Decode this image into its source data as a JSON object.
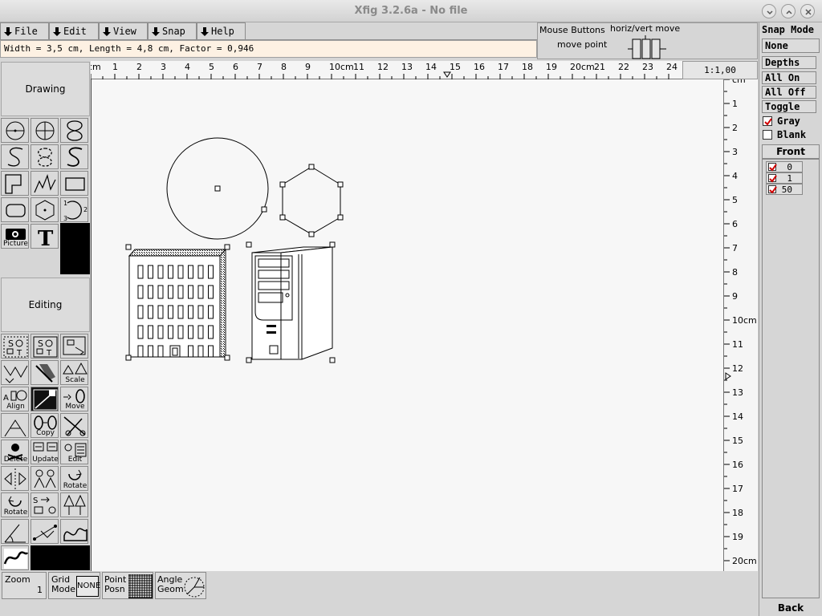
{
  "window": {
    "title": "Xfig 3.2.6a - No file",
    "controls": [
      "minimize-icon",
      "maximize-icon",
      "close-icon"
    ]
  },
  "menubar": {
    "items": [
      {
        "label": "File"
      },
      {
        "label": "Edit"
      },
      {
        "label": "View"
      },
      {
        "label": "Snap"
      },
      {
        "label": "Help"
      }
    ]
  },
  "message": {
    "text": "Width = 3,5 cm, Length = 4,8 cm, Factor = 0,946"
  },
  "mouse_panel": {
    "title": "Mouse Buttons",
    "left_action": "move point",
    "right_action": "horiz/vert move"
  },
  "zoom_display": "1:1,00",
  "modes": {
    "drawing_label": "Drawing",
    "editing_label": "Editing"
  },
  "drawing_tools": [
    {
      "icon": "circle-by-radius-icon"
    },
    {
      "icon": "circle-by-diameter-icon"
    },
    {
      "icon": "closed-spline-icon"
    },
    {
      "icon": "open-approx-spline-icon"
    },
    {
      "icon": "closed-approx-spline-icon"
    },
    {
      "icon": "open-interp-spline-icon"
    },
    {
      "icon": "polygon-icon"
    },
    {
      "icon": "polyline-icon"
    },
    {
      "icon": "box-icon"
    },
    {
      "icon": "rounded-box-icon"
    },
    {
      "icon": "regular-polygon-icon"
    },
    {
      "icon": "arc-icon"
    },
    {
      "icon": "picture-icon",
      "label": "Picture"
    },
    {
      "icon": "text-icon",
      "glyph": "T"
    },
    {
      "icon": "library-icon"
    }
  ],
  "editing_tools": [
    {
      "icon": "glue-compound-icon"
    },
    {
      "icon": "break-compound-icon"
    },
    {
      "icon": "open-compound-icon"
    },
    {
      "icon": "add-delete-point-icon"
    },
    {
      "icon": "add-arrow-icon"
    },
    {
      "icon": "scale-icon",
      "label": "Scale"
    },
    {
      "icon": "align-icon",
      "label": "Align"
    },
    {
      "icon": "move-point-icon",
      "selected": true
    },
    {
      "icon": "move-icon",
      "label": "Move"
    },
    {
      "icon": "add-point-icon"
    },
    {
      "icon": "copy-icon",
      "label": "Copy"
    },
    {
      "icon": "cut-icon"
    },
    {
      "icon": "delete-icon",
      "label": "Delete"
    },
    {
      "icon": "update-icon",
      "label": "Update"
    },
    {
      "icon": "edit-icon",
      "label": "Edit"
    },
    {
      "icon": "flip-icon"
    },
    {
      "icon": "flip-people-icon"
    },
    {
      "icon": "rotate-icon",
      "label": "Rotate"
    },
    {
      "icon": "rotate-ccw-icon",
      "label": "Rotate"
    },
    {
      "icon": "convert-icon"
    },
    {
      "icon": "tree-icon"
    },
    {
      "icon": "anglemeas-icon"
    },
    {
      "icon": "lenmeas-icon"
    },
    {
      "icon": "areameas-icon"
    },
    {
      "icon": "tangent-icon"
    }
  ],
  "rulers": {
    "horizontal": [
      "cm",
      "1",
      "2",
      "3",
      "4",
      "5",
      "6",
      "7",
      "8",
      "9",
      "10cm",
      "11",
      "12",
      "13",
      "14",
      "15",
      "16",
      "17",
      "18",
      "19",
      "20cm",
      "21",
      "22",
      "23",
      "24"
    ],
    "vertical": [
      "cm",
      "1",
      "2",
      "3",
      "4",
      "5",
      "6",
      "7",
      "8",
      "9",
      "10cm",
      "11",
      "12",
      "13",
      "14",
      "15",
      "16",
      "17",
      "18",
      "19",
      "20cm"
    ]
  },
  "bottom": {
    "zoom_label": "Zoom",
    "zoom_value": "1",
    "grid_label_1": "Grid",
    "grid_label_2": "Mode",
    "grid_value": "NONE",
    "point_label_1": "Point",
    "point_label_2": "Posn",
    "angle_label_1": "Angle",
    "angle_label_2": "Geom"
  },
  "right_panel": {
    "snap_label": "Snap Mode",
    "snap_value": "None",
    "depths_label": "Depths",
    "all_on": "All On",
    "all_off": "All Off",
    "toggle": "Toggle",
    "gray_label": "Gray",
    "gray_checked": true,
    "blank_label": "Blank",
    "blank_checked": false,
    "front_label": "Front",
    "depth_items": [
      {
        "label": "0",
        "checked": true
      },
      {
        "label": "1",
        "checked": true
      },
      {
        "label": "50",
        "checked": true
      }
    ],
    "back_label": "Back"
  }
}
